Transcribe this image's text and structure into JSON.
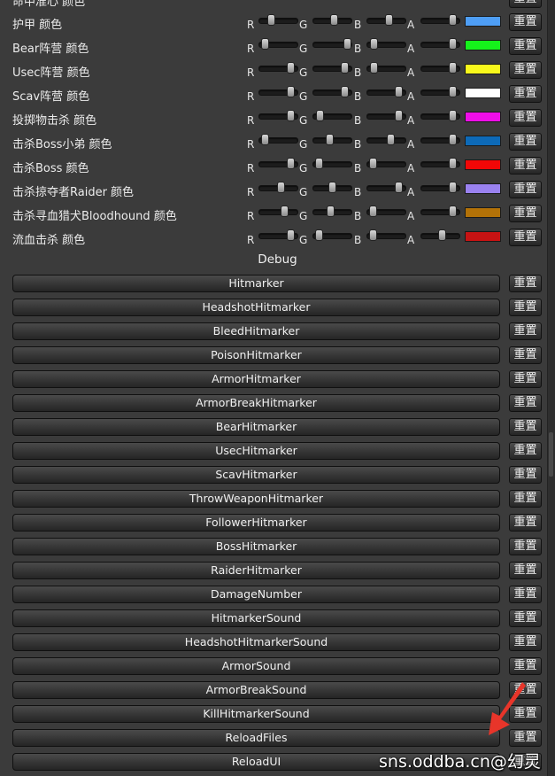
{
  "colors": {
    "background": "#3b3b3b",
    "arrow": "#e8352a"
  },
  "channel_labels": {
    "r": "R",
    "g": "G",
    "b": "B",
    "a": "A"
  },
  "reset_label": "重置",
  "partial_top_row": {
    "label": "命中准心 颜色"
  },
  "color_settings": [
    {
      "label": "护甲 颜色",
      "r": 0.25,
      "g": 0.55,
      "b": 0.6,
      "a": 0.92,
      "swatch": "#4e9ef5"
    },
    {
      "label": "Bear阵营 颜色",
      "r": 0.05,
      "g": 1.0,
      "b": 0.1,
      "a": 0.92,
      "swatch": "#15f21b"
    },
    {
      "label": "Usec阵营 颜色",
      "r": 0.92,
      "g": 0.9,
      "b": 0.1,
      "a": 0.92,
      "swatch": "#f8f81b"
    },
    {
      "label": "Scav阵营 颜色",
      "r": 0.92,
      "g": 0.92,
      "b": 0.92,
      "a": 0.92,
      "swatch": "#ffffff"
    },
    {
      "label": "投掷物击杀 颜色",
      "r": 0.92,
      "g": 0.1,
      "b": 0.92,
      "a": 0.92,
      "swatch": "#ef0ee8"
    },
    {
      "label": "击杀Boss小弟 颜色",
      "r": 0.05,
      "g": 0.4,
      "b": 0.65,
      "a": 0.92,
      "swatch": "#0d6ab8"
    },
    {
      "label": "击杀Boss 颜色",
      "r": 0.92,
      "g": 0.05,
      "b": 0.05,
      "a": 0.92,
      "swatch": "#f20707"
    },
    {
      "label": "击杀掠夺者Raider 颜色",
      "r": 0.6,
      "g": 0.5,
      "b": 0.92,
      "a": 0.92,
      "swatch": "#9a82f0"
    },
    {
      "label": "击杀寻血猎犬Bloodhound 颜色",
      "r": 0.7,
      "g": 0.45,
      "b": 0.05,
      "a": 0.92,
      "swatch": "#b37208"
    },
    {
      "label": "流血击杀 颜色",
      "r": 0.92,
      "g": 0.05,
      "b": 0.05,
      "a": 0.55,
      "swatch": "#c71313"
    }
  ],
  "debug": {
    "title": "Debug",
    "buttons": [
      "Hitmarker",
      "HeadshotHitmarker",
      "BleedHitmarker",
      "PoisonHitmarker",
      "ArmorHitmarker",
      "ArmorBreakHitmarker",
      "BearHitmarker",
      "UsecHitmarker",
      "ScavHitmarker",
      "ThrowWeaponHitmarker",
      "FollowerHitmarker",
      "BossHitmarker",
      "RaiderHitmarker",
      "DamageNumber",
      "HitmarkerSound",
      "HeadshotHitmarkerSound",
      "ArmorSound",
      "ArmorBreakSound",
      "KillHitmarkerSound",
      "ReloadFiles",
      "ReloadUI"
    ]
  },
  "watermark": "sns.oddba.cn@幻灵"
}
